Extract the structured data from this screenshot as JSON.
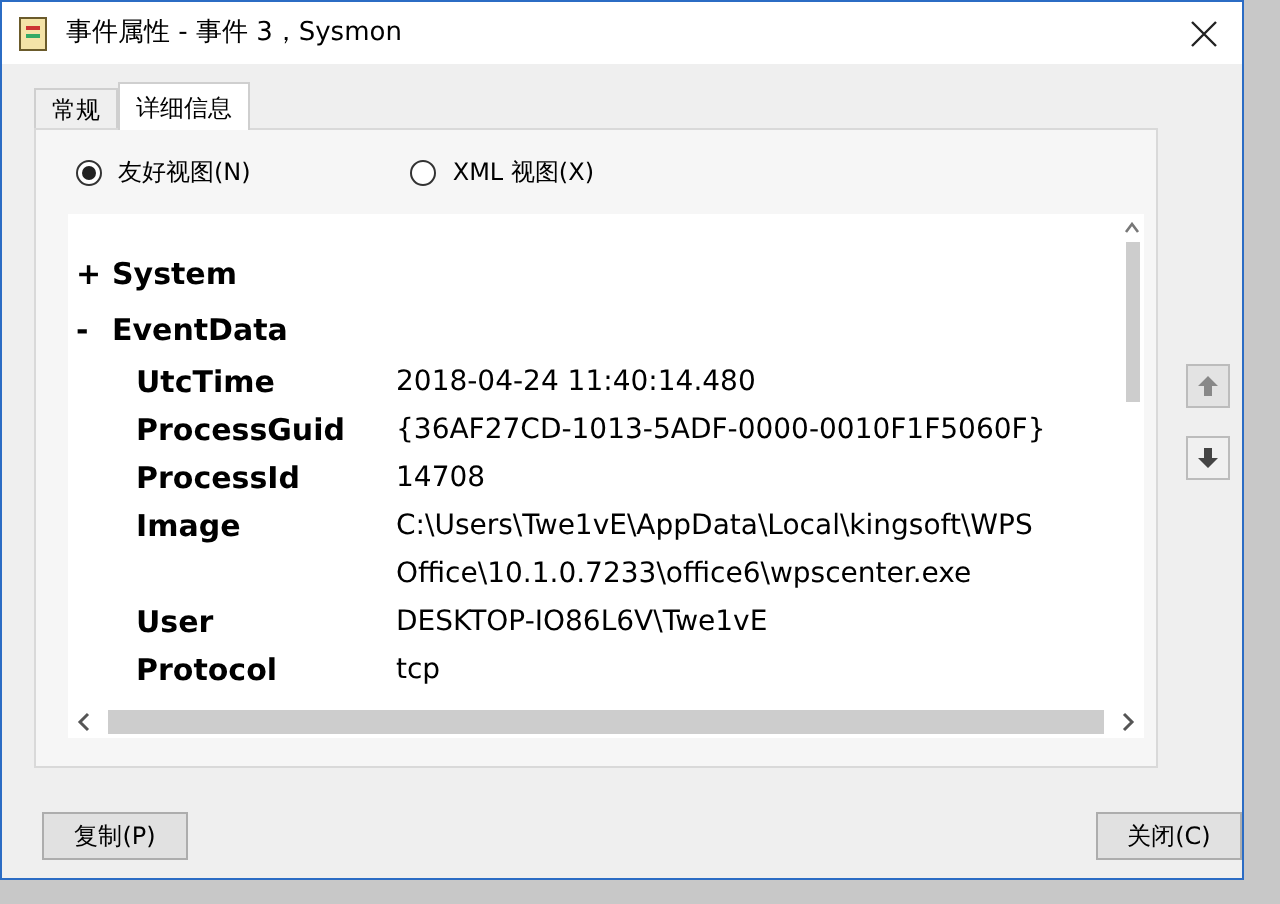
{
  "window": {
    "title": "事件属性 - 事件 3，Sysmon"
  },
  "tabs": [
    {
      "label": "常规",
      "selected": false
    },
    {
      "label": "详细信息",
      "selected": true
    }
  ],
  "view_options": [
    {
      "label": "友好视图(N)",
      "selected": true
    },
    {
      "label": "XML 视图(X)",
      "selected": false
    }
  ],
  "tree": [
    {
      "name": "System",
      "toggle": "+"
    },
    {
      "name": "EventData",
      "toggle": "-",
      "children": [
        {
          "name": "UtcTime",
          "value": "2018-04-24 11:40:14.480"
        },
        {
          "name": "ProcessGuid",
          "value": "{36AF27CD-1013-5ADF-0000-0010F1F5060F}"
        },
        {
          "name": "ProcessId",
          "value": "14708"
        },
        {
          "name": "Image",
          "value": "C:\\Users\\Twe1vE\\AppData\\Local\\kingsoft\\WPS Office\\10.1.0.7233\\office6\\wpscenter.exe"
        },
        {
          "name": "User",
          "value": "DESKTOP-IO86L6V\\Twe1vE"
        },
        {
          "name": "Protocol",
          "value": "tcp"
        }
      ]
    }
  ],
  "buttons": {
    "copy": "复制(P)",
    "close": "关闭(C)"
  }
}
